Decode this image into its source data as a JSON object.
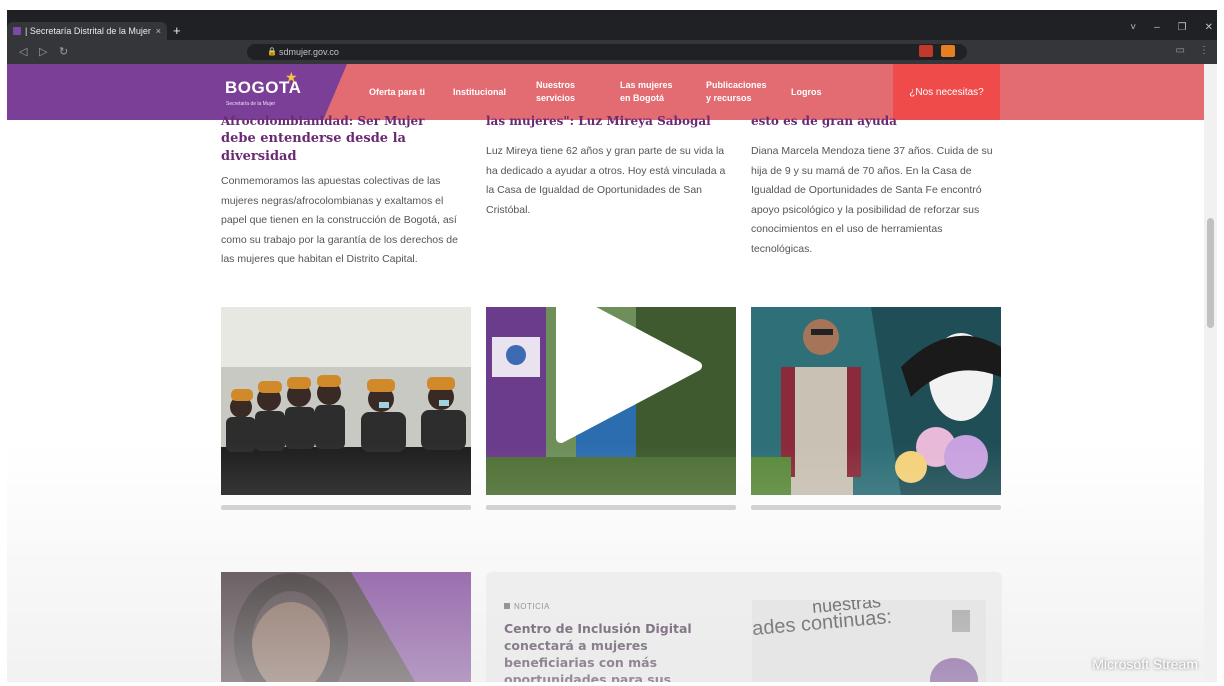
{
  "browser": {
    "tab_title": "| Secretaría Distrital de la Mujer",
    "tab_close": "×",
    "new_tab": "+",
    "url": "sdmujer.gov.co",
    "window_controls": [
      "˅",
      "–",
      "❐",
      "✕"
    ]
  },
  "header": {
    "logo": "BOGOTA",
    "logo_sub": "Secretaría de la Mujer",
    "menu": [
      {
        "line1": "Oferta para ti",
        "line2": ""
      },
      {
        "line1": "Institucional",
        "line2": ""
      },
      {
        "line1": "Nuestros",
        "line2": "servicios"
      },
      {
        "line1": "Las mujeres",
        "line2": "en Bogotá"
      },
      {
        "line1": "Publicaciones",
        "line2": "y recursos"
      },
      {
        "line1": "Logros",
        "line2": ""
      }
    ],
    "cta": "¿Nos necesitas?"
  },
  "articles": [
    {
      "title_cut": "Afrocolombianidad: Ser Mujer",
      "title": "debe entenderse desde la diversidad",
      "body": "Conmemoramos las apuestas colectivas de las mujeres negras/afrocolombianas y exaltamos el papel que tienen en la construcción de Bogotá, así como su trabajo por la garantía de los derechos de las mujeres que habitan el Distrito Capital."
    },
    {
      "title_cut": "las mujeres\": Luz Mireya Sabogal",
      "title": "",
      "body": "Luz Mireya tiene 62 años y gran parte de su vida la ha dedicado a ayudar a otros. Hoy está vinculada a la Casa de Igualdad de Oportunidades de San Cristóbal."
    },
    {
      "title_cut": "esto es de gran ayuda",
      "title": "",
      "body": "Diana Marcela Mendoza tiene 37 años. Cuida de su hija de 9 y su mamá de 70 años. En la Casa de Igualdad de Oportunidades de Santa Fe encontró apoyo psicológico y la posibilidad de reforzar sus conocimientos en el uso de herramientas tecnológicas."
    }
  ],
  "lower": {
    "tag": "NOTICIA",
    "title": "Centro de Inclusión Digital conectará a mujeres beneficiarias con más oportunidades para sus",
    "photo_text1": "nuestras",
    "photo_text2": "ades continuas:"
  },
  "overlay": {
    "watermark": "Microsoft Stream"
  },
  "colors": {
    "header_pink": "#e36b72",
    "header_purple": "#7b3f98",
    "cta_red": "#ef4b4b",
    "title_purple": "#6a2a73"
  }
}
